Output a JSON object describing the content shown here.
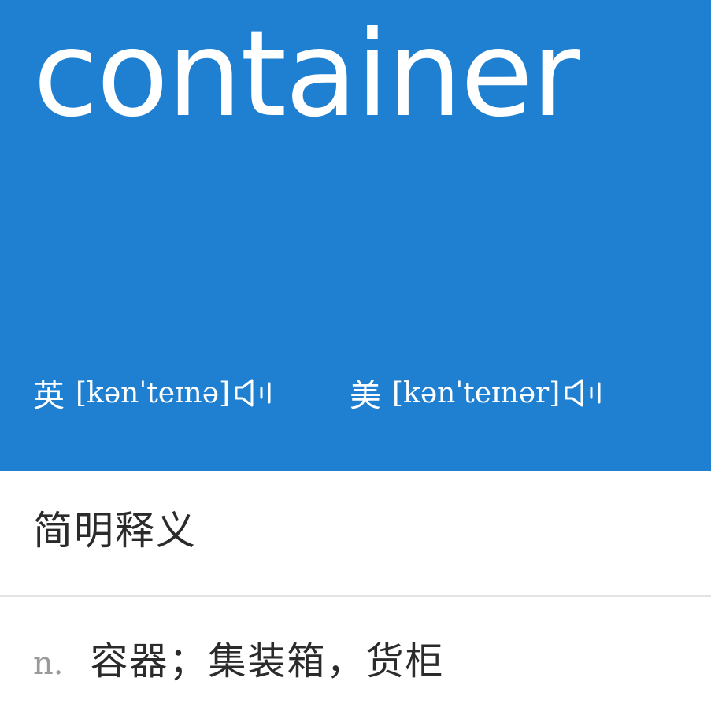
{
  "header": {
    "word": "container",
    "background_color": "#1f80d2",
    "pronunciations": [
      {
        "label": "英",
        "ipa": "[kənˈteɪnə]",
        "icon": "speaker-icon"
      },
      {
        "label": "美",
        "ipa": "[kənˈteɪnər]",
        "icon": "speaker-icon"
      }
    ]
  },
  "definitions_section": {
    "title": "简明释义",
    "entries": [
      {
        "pos": "n.",
        "meaning": "容器；集装箱，货柜"
      }
    ]
  }
}
